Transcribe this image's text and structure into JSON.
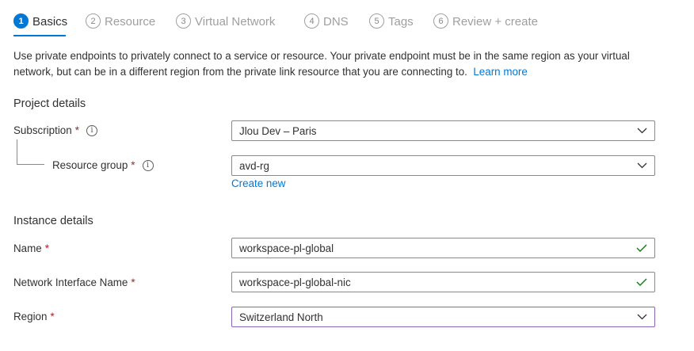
{
  "tabs": [
    {
      "num": "1",
      "label": "Basics",
      "active": true
    },
    {
      "num": "2",
      "label": "Resource"
    },
    {
      "num": "3",
      "label": "Virtual Network"
    },
    {
      "num": "4",
      "label": "DNS"
    },
    {
      "num": "5",
      "label": "Tags"
    },
    {
      "num": "6",
      "label": "Review + create"
    }
  ],
  "description": {
    "text": "Use private endpoints to privately connect to a service or resource. Your private endpoint must be in the same region as your virtual network, but can be in a different region from the private link resource that you are connecting to.",
    "learn_more": "Learn more"
  },
  "project_details": {
    "title": "Project details",
    "subscription": {
      "label": "Subscription",
      "required": "*",
      "value": "Jlou Dev – Paris"
    },
    "resource_group": {
      "label": "Resource group",
      "required": "*",
      "value": "avd-rg",
      "create_new": "Create new"
    }
  },
  "instance_details": {
    "title": "Instance details",
    "name": {
      "label": "Name",
      "required": "*",
      "value": "workspace-pl-global"
    },
    "nic_name": {
      "label": "Network Interface Name",
      "required": "*",
      "value": "workspace-pl-global-nic"
    },
    "region": {
      "label": "Region",
      "required": "*",
      "value": "Switzerland North"
    }
  },
  "icons": {
    "info": "info-icon",
    "dropdown": "chevron-down-icon",
    "valid": "checkmark-icon"
  },
  "colors": {
    "accent": "#0078d4",
    "required": "#a4262c",
    "valid": "#107c10",
    "focus": "#8764b8"
  }
}
